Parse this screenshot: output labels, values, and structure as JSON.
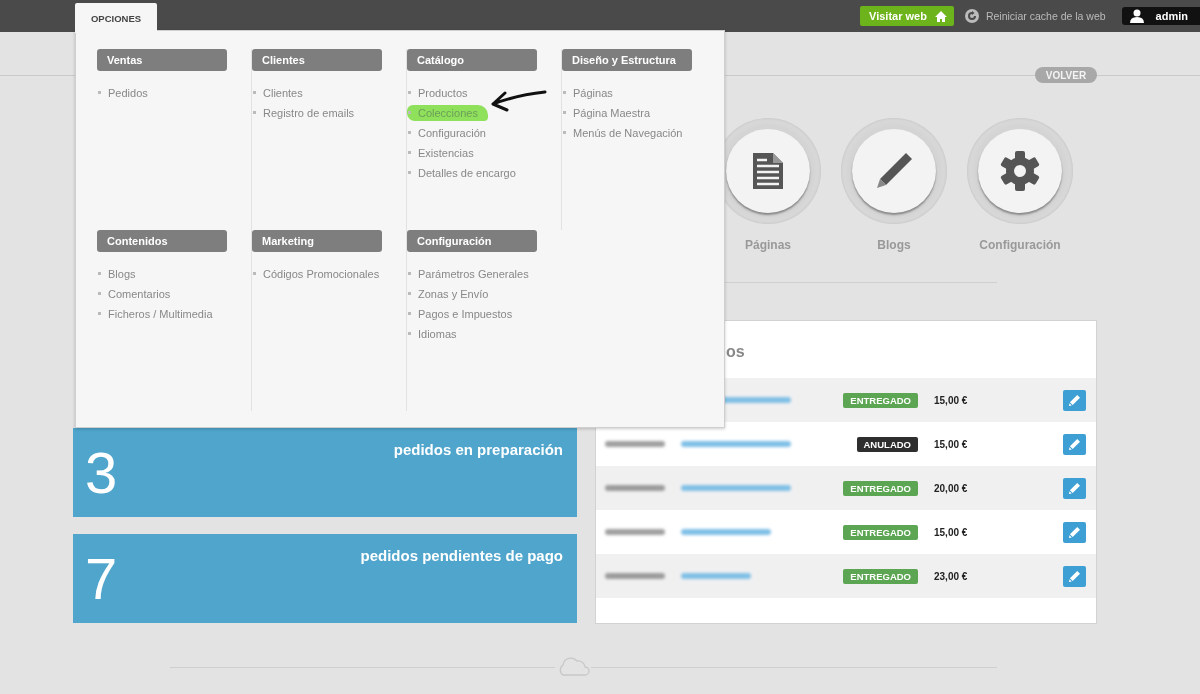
{
  "topbar": {
    "tab": {
      "label": "OPCIONES",
      "selected": true
    },
    "visit_button": "Visitar web",
    "cache_link": "Reiniciar cache de la web",
    "user": "admin"
  },
  "menu": {
    "rows": [
      {
        "sections": [
          {
            "title": "Ventas",
            "items": [
              {
                "label": "Pedidos",
                "highlighted": false
              }
            ]
          },
          {
            "title": "Clientes",
            "items": [
              {
                "label": "Clientes",
                "highlighted": false
              },
              {
                "label": "Registro de emails",
                "highlighted": false
              }
            ]
          },
          {
            "title": "Catálogo",
            "items": [
              {
                "label": "Productos",
                "highlighted": false
              },
              {
                "label": "Colecciones",
                "highlighted": true
              },
              {
                "label": "Configuración",
                "highlighted": false
              },
              {
                "label": "Existencias",
                "highlighted": false
              },
              {
                "label": "Detalles de encargo",
                "highlighted": false
              }
            ]
          },
          {
            "title": "Diseño y Estructura",
            "items": [
              {
                "label": "Páginas",
                "highlighted": false
              },
              {
                "label": "Página Maestra",
                "highlighted": false
              },
              {
                "label": "Menús de Navegación",
                "highlighted": false
              }
            ]
          }
        ]
      },
      {
        "sections": [
          {
            "title": "Contenidos",
            "items": [
              {
                "label": "Blogs",
                "highlighted": false
              },
              {
                "label": "Comentarios",
                "highlighted": false
              },
              {
                "label": "Ficheros / Multimedia",
                "highlighted": false
              }
            ]
          },
          {
            "title": "Marketing",
            "items": [
              {
                "label": "Códigos Promocionales",
                "highlighted": false
              }
            ]
          },
          {
            "title": "Configuración",
            "items": [
              {
                "label": "Parámetros Generales",
                "highlighted": false
              },
              {
                "label": "Zonas y Envío",
                "highlighted": false
              },
              {
                "label": "Pagos e Impuestos",
                "highlighted": false
              },
              {
                "label": "Idiomas",
                "highlighted": false
              }
            ]
          }
        ]
      }
    ]
  },
  "back_button": "VOLVER",
  "shortcuts": [
    {
      "label": "Páginas",
      "kind": "document"
    },
    {
      "label": "Blogs",
      "kind": "pencil"
    },
    {
      "label": "Configuración",
      "kind": "gear"
    }
  ],
  "stat_cards": [
    {
      "value": "3",
      "label": "pedidos en preparación"
    },
    {
      "value": "7",
      "label": "pedidos pendientes de pago"
    }
  ],
  "orders": {
    "heading": "os",
    "rows": [
      {
        "status": "ENTREGADO",
        "color": "#5ca552",
        "amount": "15,00 €"
      },
      {
        "status": "ANULADO",
        "color": "#2e2e2e",
        "amount": "15,00 €"
      },
      {
        "status": "ENTREGADO",
        "color": "#5ca552",
        "amount": "20,00 €"
      },
      {
        "status": "ENTREGADO",
        "color": "#5ca552",
        "amount": "15,00 €"
      },
      {
        "status": "ENTREGADO",
        "color": "#5ca552",
        "amount": "23,00 €"
      }
    ]
  }
}
